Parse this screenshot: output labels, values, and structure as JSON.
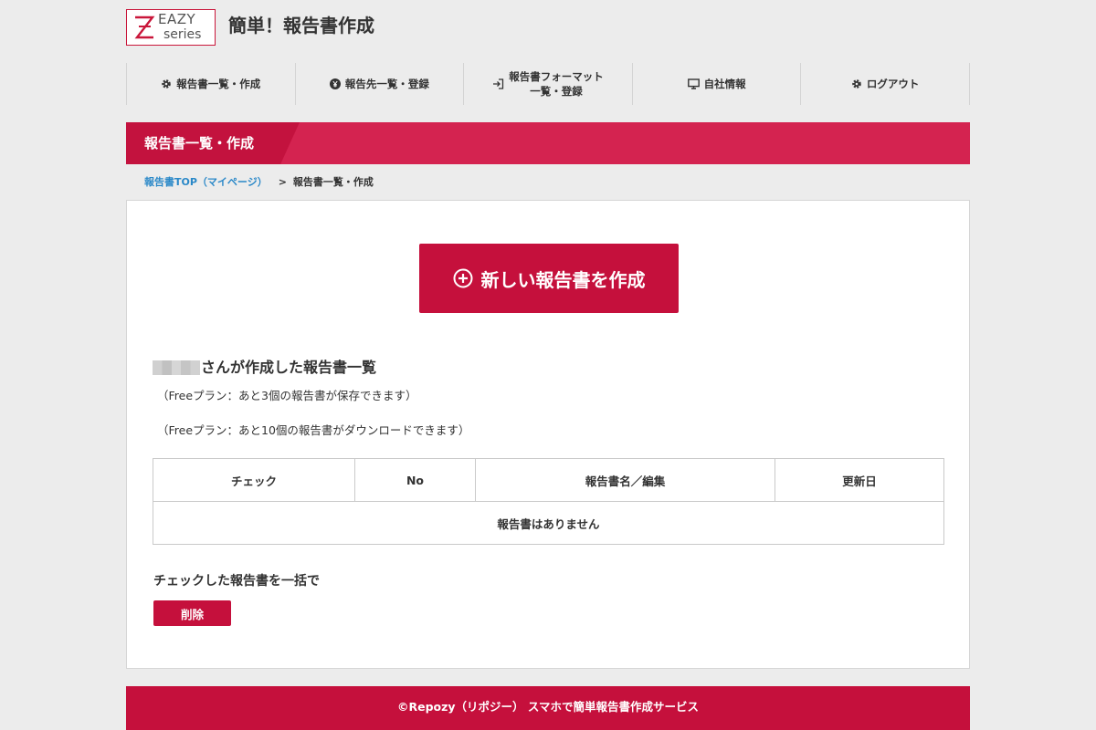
{
  "header": {
    "logo": {
      "top": "EAZY",
      "bottom": "series"
    },
    "title": "簡単！報告書作成"
  },
  "nav": [
    {
      "label": "報告書一覧・作成",
      "icon": "gear-icon"
    },
    {
      "label": "報告先一覧・登録",
      "icon": "yen-icon"
    },
    {
      "label_line1": "報告書フォーマット",
      "label_line2": "一覧・登録",
      "icon": "sign-in-icon"
    },
    {
      "label": "自社情報",
      "icon": "monitor-icon"
    },
    {
      "label": "ログアウト",
      "icon": "gear-icon"
    }
  ],
  "banner": {
    "title": "報告書一覧・作成"
  },
  "breadcrumb": {
    "link": "報告書TOP（マイページ）",
    "separator": ">",
    "current": "報告書一覧・作成"
  },
  "main": {
    "create_button": "新しい報告書を作成",
    "list_title_suffix": "さんが作成した報告書一覧",
    "plan_note_save": "（Freeプラン：あと3個の報告書が保存できます）",
    "plan_note_download": "（Freeプラン：あと10個の報告書がダウンロードできます）",
    "table": {
      "headers": [
        "チェック",
        "No",
        "報告書名／編集",
        "更新日"
      ],
      "empty_message": "報告書はありません"
    },
    "bulk_label": "チェックした報告書を一括で",
    "delete_button": "削除"
  },
  "footer": {
    "text": "©Repozy（リポジー） スマホで簡単報告書作成サービス"
  },
  "colors": {
    "brand": "#c5103c",
    "banner": "#d42350",
    "link": "#2a88c8",
    "background": "#ececec"
  }
}
